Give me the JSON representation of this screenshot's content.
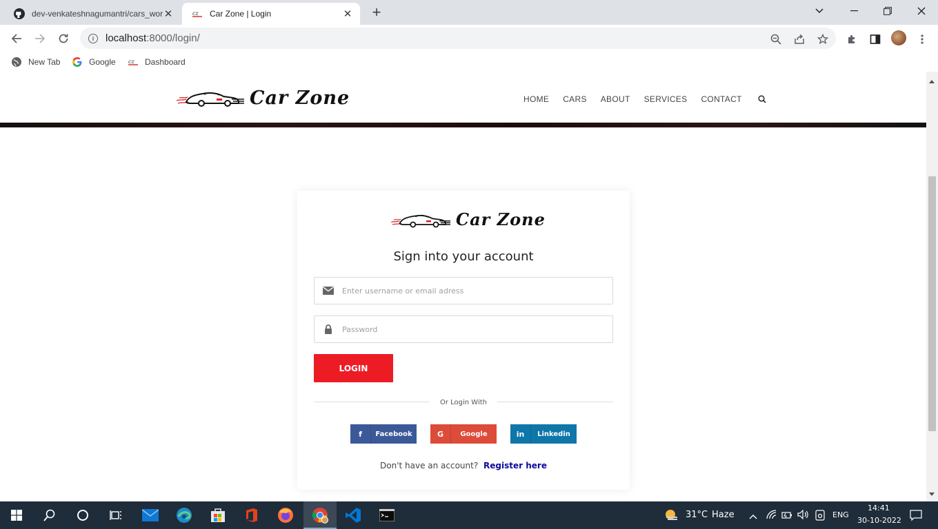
{
  "browser": {
    "tabs": [
      {
        "title": "dev-venkateshnagumantri/cars_wor",
        "favicon": "github-icon"
      },
      {
        "title": "Car Zone | Login",
        "favicon": "carzone-favicon"
      }
    ],
    "url_host": "localhost",
    "url_rest": ":8000/login/",
    "bookmarks": [
      {
        "label": "New Tab",
        "icon": "globe-icon"
      },
      {
        "label": "Google",
        "icon": "google-icon"
      },
      {
        "label": "Dashboard",
        "icon": "carzone-favicon"
      }
    ]
  },
  "site": {
    "brand": "Car Zone",
    "nav": [
      "HOME",
      "CARS",
      "ABOUT",
      "SERVICES",
      "CONTACT"
    ]
  },
  "login": {
    "brand": "Car Zone",
    "heading": "Sign into your account",
    "username_placeholder": "Enter username or email adress",
    "password_placeholder": "Password",
    "login_label": "LOGIN",
    "divider_text": "Or Login With",
    "social": [
      {
        "label": "Facebook",
        "icon_glyph": "f",
        "color": "#3b5998"
      },
      {
        "label": "Google",
        "icon_glyph": "G",
        "color": "#dd4b39"
      },
      {
        "label": "Linkedin",
        "icon_glyph": "in",
        "color": "#0e76a8"
      }
    ],
    "register_prompt": "Don't have an account?",
    "register_link": "Register here"
  },
  "colors": {
    "accent_red": "#ed1c24",
    "link_blue": "#0b0b9c",
    "taskbar": "#1f2c3a"
  },
  "taskbar": {
    "weather_temp": "31°C",
    "weather_desc": "Haze",
    "language": "ENG",
    "time": "14:41",
    "date": "30-10-2022"
  }
}
